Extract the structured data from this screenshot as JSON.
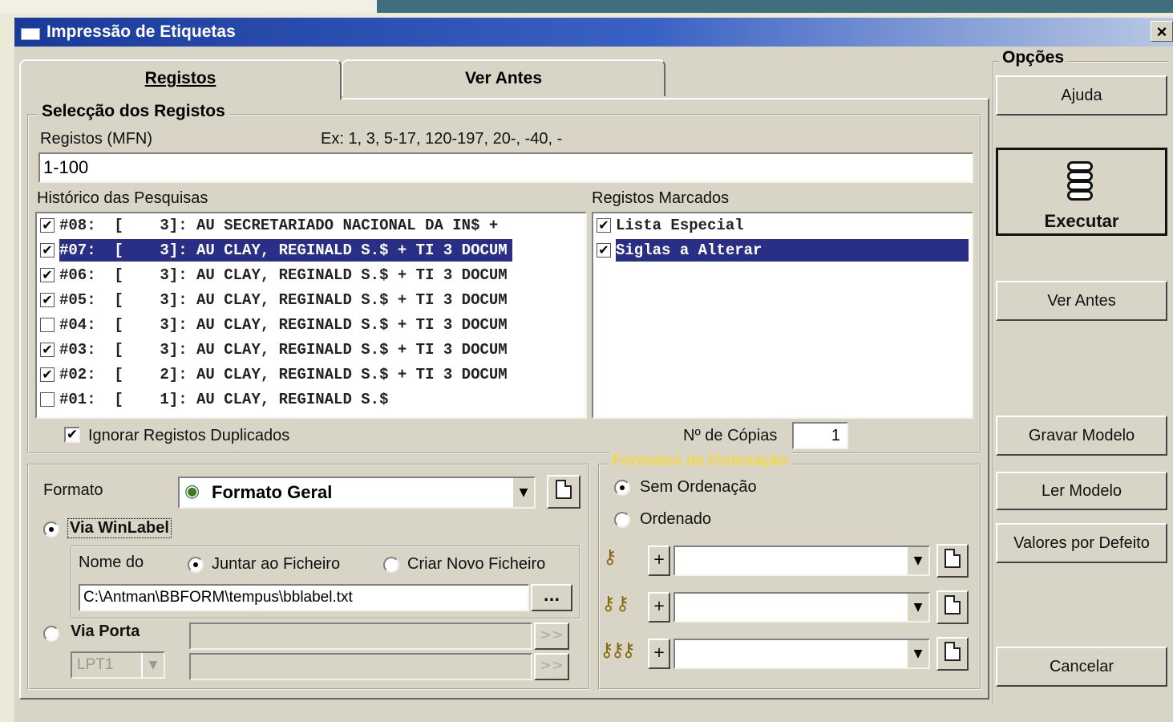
{
  "window": {
    "title": "Impressão de Etiquetas",
    "close_label": "×"
  },
  "tabs": [
    {
      "label": "Registos",
      "active": true
    },
    {
      "label": "Ver Antes",
      "active": false
    }
  ],
  "selection": {
    "group_title": "Selecção dos Registos",
    "mfn_label": "Registos (MFN)",
    "example": "Ex: 1,  3,  5-17, 120-197, 20-, -40, -",
    "mfn_value": "1-100",
    "history_label": "Histórico das Pesquisas",
    "history": [
      {
        "checked": true,
        "text": "#08:  [    3]: AU SECRETARIADO NACIONAL DA IN$ +",
        "selected": false
      },
      {
        "checked": true,
        "text": "#07:  [    3]: AU CLAY, REGINALD S.$ + TI 3 DOCUM",
        "selected": true
      },
      {
        "checked": true,
        "text": "#06:  [    3]: AU CLAY, REGINALD S.$ + TI 3 DOCUM",
        "selected": false
      },
      {
        "checked": true,
        "text": "#05:  [    3]: AU CLAY, REGINALD S.$ + TI 3 DOCUM",
        "selected": false
      },
      {
        "checked": false,
        "text": "#04:  [    3]: AU CLAY, REGINALD S.$ + TI 3 DOCUM",
        "selected": false
      },
      {
        "checked": true,
        "text": "#03:  [    3]: AU CLAY, REGINALD S.$ + TI 3 DOCUM",
        "selected": false
      },
      {
        "checked": true,
        "text": "#02:  [    2]: AU CLAY, REGINALD S.$ + TI 3 DOCUM",
        "selected": false
      },
      {
        "checked": false,
        "text": "#01:  [    1]: AU CLAY, REGINALD S.$",
        "selected": false
      }
    ],
    "marked_label": "Registos Marcados",
    "marked": [
      {
        "checked": true,
        "text": "Lista Especial",
        "selected": false
      },
      {
        "checked": true,
        "text": "Siglas a Alterar",
        "selected": true
      }
    ],
    "ignore_duplicates_label": "Ignorar Registos Duplicados",
    "ignore_duplicates_checked": true,
    "copies_label": "Nº de Cópias",
    "copies_value": "1"
  },
  "format": {
    "label": "Formato",
    "selected": "Formato Geral",
    "via_winlabel_label": "Via WinLabel",
    "via_winlabel_selected": true,
    "file_name_label": "Nome do",
    "append_label": "Juntar ao Ficheiro",
    "append_selected": true,
    "new_file_label": "Criar Novo Ficheiro",
    "file_path": "C:\\Antman\\BBFORM\\tempus\\bblabel.txt",
    "browse_label": "...",
    "via_porta_label": "Via Porta",
    "port_value": "LPT1",
    "send_label": ">>"
  },
  "ordering": {
    "group_title": "Formatos de Ordenação",
    "title_color": "#f5d84a",
    "no_order_label": "Sem Ordenação",
    "no_order_selected": true,
    "ordered_label": "Ordenado",
    "plus_label": "+",
    "rows": [
      {
        "icon": "single-key-icon"
      },
      {
        "icon": "double-key-icon"
      },
      {
        "icon": "triple-key-icon"
      }
    ]
  },
  "options": {
    "group_title": "Opções",
    "help": "Ajuda",
    "execute": "Executar",
    "preview": "Ver Antes",
    "save_model": "Gravar Modelo",
    "load_model": "Ler Modelo",
    "defaults": "Valores por Defeito",
    "cancel": "Cancelar"
  },
  "colors": {
    "selection": "#2a2f86",
    "title_bar": "#1a3a9a"
  }
}
